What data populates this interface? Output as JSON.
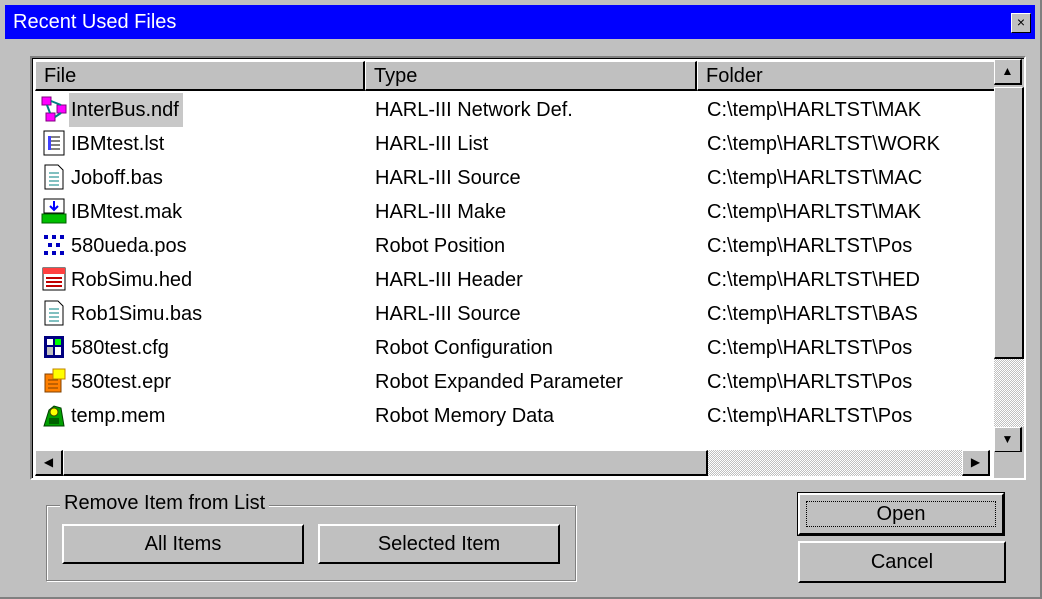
{
  "window": {
    "title": "Recent Used Files",
    "close_label": "×"
  },
  "columns": [
    {
      "label": "File"
    },
    {
      "label": "Type"
    },
    {
      "label": "Folder"
    }
  ],
  "rows": [
    {
      "file": "InterBus.ndf",
      "type": "HARL-III Network Def.",
      "folder": "C:\\temp\\HARLTST\\MAK",
      "icon": "network-def-icon",
      "selected": true
    },
    {
      "file": "IBMtest.lst",
      "type": "HARL-III List",
      "folder": "C:\\temp\\HARLTST\\WORK",
      "icon": "list-file-icon"
    },
    {
      "file": "Joboff.bas",
      "type": "HARL-III Source",
      "folder": "C:\\temp\\HARLTST\\MAC",
      "icon": "source-file-icon"
    },
    {
      "file": "IBMtest.mak",
      "type": "HARL-III Make",
      "folder": "C:\\temp\\HARLTST\\MAK",
      "icon": "make-file-icon"
    },
    {
      "file": "580ueda.pos",
      "type": "Robot Position",
      "folder": "C:\\temp\\HARLTST\\Pos",
      "icon": "position-file-icon"
    },
    {
      "file": "RobSimu.hed",
      "type": "HARL-III Header",
      "folder": "C:\\temp\\HARLTST\\HED",
      "icon": "header-file-icon"
    },
    {
      "file": "Rob1Simu.bas",
      "type": "HARL-III Source",
      "folder": "C:\\temp\\HARLTST\\BAS",
      "icon": "source-file-icon"
    },
    {
      "file": "580test.cfg",
      "type": "Robot Configuration",
      "folder": "C:\\temp\\HARLTST\\Pos",
      "icon": "config-file-icon"
    },
    {
      "file": "580test.epr",
      "type": "Robot Expanded Parameter",
      "folder": "C:\\temp\\HARLTST\\Pos",
      "icon": "parameter-file-icon"
    },
    {
      "file": "temp.mem",
      "type": "Robot Memory Data",
      "folder": "C:\\temp\\HARLTST\\Pos",
      "icon": "memory-file-icon"
    }
  ],
  "remove_group": {
    "label": "Remove Item from List",
    "all_items": "All Items",
    "selected_item": "Selected Item"
  },
  "actions": {
    "open": "Open",
    "cancel": "Cancel"
  },
  "scrollbar": {
    "up": "▲",
    "down": "▼",
    "left": "◀",
    "right": "▶"
  },
  "colors": {
    "titlebar": "#0000ff",
    "face": "#c0c0c0",
    "selection": "#c8c8c8"
  }
}
